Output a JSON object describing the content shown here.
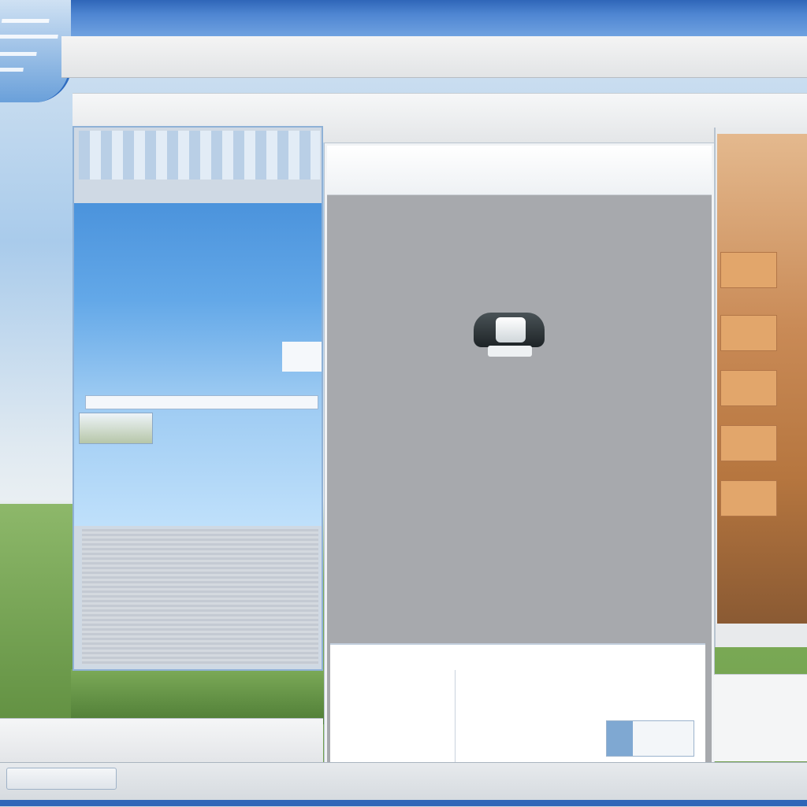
{
  "topbar": {
    "title": ""
  },
  "menubar": {
    "items": [
      "",
      "",
      "",
      ""
    ]
  },
  "frame": {
    "title": ""
  },
  "left_window": {
    "lines": [
      "",
      "",
      "",
      "",
      "",
      "",
      "",
      "",
      "",
      ""
    ]
  },
  "dialog": {
    "header_line1": "",
    "header_line2": "",
    "icon": "camera-icon",
    "footer": {
      "col1": [
        "",
        "",
        "",
        "",
        ""
      ],
      "col2": [
        "",
        "",
        "",
        ""
      ],
      "col3": [
        "",
        "",
        ""
      ]
    }
  },
  "bottom_strip": {
    "labels": [
      "",
      "",
      "",
      ""
    ]
  },
  "taskbar": {
    "button_label": ""
  },
  "colors": {
    "titlebar_blue": "#2f66b8",
    "dialog_gray": "#a7a9ad",
    "panel_blue": "#63a8e8"
  }
}
